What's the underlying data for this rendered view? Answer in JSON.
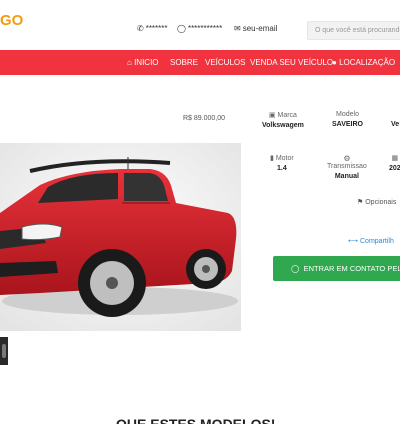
{
  "brand": {
    "logo_text": "GO"
  },
  "header": {
    "phone": "*******",
    "whatsapp": "***********",
    "email": "seu-email",
    "search_placeholder": "O que você está procurando"
  },
  "nav": {
    "items": [
      "INICIO",
      "SOBRE",
      "VEÍCULOS",
      "VENDA SEU VEÍCULO",
      "LOCALIZAÇÃO"
    ]
  },
  "vehicle": {
    "price": "R$ 89.000,00",
    "specs": [
      {
        "label": "Marca",
        "value": "Volkswagem",
        "icon": "car-icon"
      },
      {
        "label": "Modelo",
        "value": "SAVEIRO",
        "icon": ""
      },
      {
        "label": "",
        "value": "Ve",
        "icon": ""
      },
      {
        "label": "Motor",
        "value": "1.4",
        "icon": "engine-icon"
      },
      {
        "label": "Transmissao",
        "value": "Manual",
        "icon": "gear-icon"
      },
      {
        "label": "",
        "value": "202",
        "icon": "calendar-icon"
      }
    ],
    "optionals_label": "Opcionais",
    "share_label": "Compartilh",
    "cta_label": "ENTRAR EM CONTATO PELO"
  },
  "section": {
    "title": "QUE ESTES MODELOS!"
  },
  "colors": {
    "accent": "#f0333f",
    "logo": "#f39c12",
    "cta": "#2fa84f",
    "link": "#2a8ad6"
  }
}
